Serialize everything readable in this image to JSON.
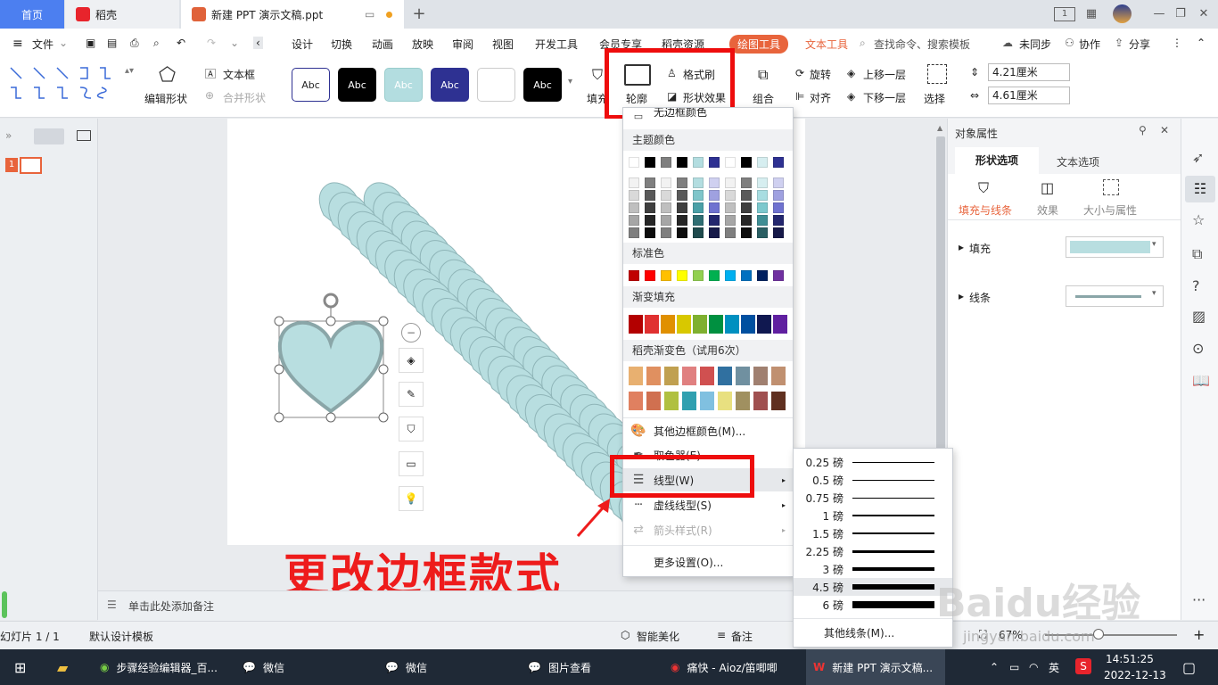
{
  "titlebar": {
    "home_tab": "首页",
    "docer_tab": "稻壳",
    "doc_tab": "新建 PPT 演示文稿.ppt",
    "add_tab": "+",
    "layout_badge": "1"
  },
  "menu": {
    "file": "文件",
    "items": [
      "设计",
      "切换",
      "动画",
      "放映",
      "审阅",
      "视图",
      "开发工具",
      "会员专享",
      "稻壳资源"
    ],
    "drawing_tools": "绘图工具",
    "text_tools": "文本工具",
    "search": "查找命令、搜索模板",
    "sync": "未同步",
    "collab": "协作",
    "share": "分享"
  },
  "ribbon": {
    "edit_shape": "编辑形状",
    "textbox": "文本框",
    "merge_shape": "合并形状",
    "style_sample": "Abc",
    "fill": "填充",
    "outline": "轮廓",
    "format_painter": "格式刷",
    "shape_effects": "形状效果",
    "group": "组合",
    "rotate": "旋转",
    "align": "对齐",
    "bring_forward": "上移一层",
    "send_backward": "下移一层",
    "select": "选择",
    "height": "4.21厘米",
    "width": "4.61厘米"
  },
  "slides_panel": {
    "slide_number": "1"
  },
  "notes_placeholder": "单击此处添加备注",
  "color_menu": {
    "top_partial": "无边框颜色",
    "theme_colors": "主题颜色",
    "standard_colors": "标准色",
    "gradient_fill": "渐变填充",
    "docer_gradient": "稻壳渐变色（试用6次）",
    "more_colors": "其他边框颜色(M)...",
    "eyedropper": "取色器(E)",
    "line_style": "线型(W)",
    "dash_style": "虚线线型(S)",
    "arrow_style": "箭头样式(R)",
    "more_settings": "更多设置(O)...",
    "theme_row": [
      "#ffffff",
      "#000000",
      "#7f7f7f",
      "#000000",
      "#b3dde0",
      "#2e3192",
      "#ffffff",
      "#000000",
      "#d6eef0",
      "#2e3192"
    ],
    "theme_grid": [
      [
        "#f2f2f2",
        "#7f7f7f",
        "#f2f2f2",
        "#7f7f7f",
        "#b3dde0",
        "#cfd0f0",
        "#f2f2f2",
        "#7f7f7f",
        "#d6eef0",
        "#cfd0f0"
      ],
      [
        "#d9d9d9",
        "#595959",
        "#d9d9d9",
        "#595959",
        "#7fc5ca",
        "#9fa1e0",
        "#d9d9d9",
        "#595959",
        "#a8dde1",
        "#9fa1e0"
      ],
      [
        "#bfbfbf",
        "#3f3f3f",
        "#bfbfbf",
        "#3f3f3f",
        "#4aa0a7",
        "#6f72d0",
        "#bfbfbf",
        "#3f3f3f",
        "#7cc8cd",
        "#6f72d0"
      ],
      [
        "#a6a6a6",
        "#262626",
        "#a6a6a6",
        "#262626",
        "#2f6e73",
        "#23266e",
        "#a6a6a6",
        "#262626",
        "#3f8e94",
        "#23266e"
      ],
      [
        "#7f7f7f",
        "#0d0d0d",
        "#7f7f7f",
        "#0d0d0d",
        "#1f4a4d",
        "#171a49",
        "#7f7f7f",
        "#0d0d0d",
        "#2a5f63",
        "#171a49"
      ]
    ],
    "standard_row": [
      "#c00000",
      "#ff0000",
      "#ffc000",
      "#ffff00",
      "#92d050",
      "#00b050",
      "#00b0f0",
      "#0070c0",
      "#002060",
      "#7030a0"
    ],
    "gradient_row": [
      "#b30000",
      "#e03030",
      "#e09000",
      "#d8c800",
      "#7fb030",
      "#009040",
      "#0090c0",
      "#0050a0",
      "#101850",
      "#6020a0"
    ],
    "docer_row1": [
      "#e8b070",
      "#e09060",
      "#c0a050",
      "#e08080",
      "#d05050",
      "#3070a0",
      "#7090a0",
      "#a08070",
      "#c09070"
    ],
    "docer_row2": [
      "#e08060",
      "#d07050",
      "#b0c040",
      "#30a0b0",
      "#80c0e0",
      "#e8e080",
      "#a09060",
      "#a05050",
      "#603020"
    ]
  },
  "line_menu": {
    "weights": [
      "0.25 磅",
      "0.5 磅",
      "0.75 磅",
      "1 磅",
      "1.5 磅",
      "2.25 磅",
      "3 磅",
      "4.5 磅",
      "6 磅"
    ],
    "more_lines": "其他线条(M)..."
  },
  "right_panel": {
    "title": "对象属性",
    "tab_shape": "形状选项",
    "tab_text": "文本选项",
    "sub_fill_line": "填充与线条",
    "sub_effects": "效果",
    "sub_size": "大小与属性",
    "fill": "填充",
    "line": "线条",
    "fill_color": "#b8dee0"
  },
  "annotation": "更改边框款式",
  "statusbar": {
    "slide_info": "幻灯片 1 / 1",
    "template": "默认设计模板",
    "smart_beautify": "智能美化",
    "notes": "备注",
    "zoom": "67%"
  },
  "taskbar": {
    "apps": [
      "步骤经验编辑器_百...",
      "微信",
      "微信",
      "图片查看",
      "痛快 - Aioz/笛唧唧",
      "新建 PPT 演示文稿..."
    ],
    "ime": "英",
    "time": "14:51:25",
    "date": "2022-12-13"
  },
  "watermark": "Baidu经验",
  "watermark_url": "jingyan.baidu.com"
}
